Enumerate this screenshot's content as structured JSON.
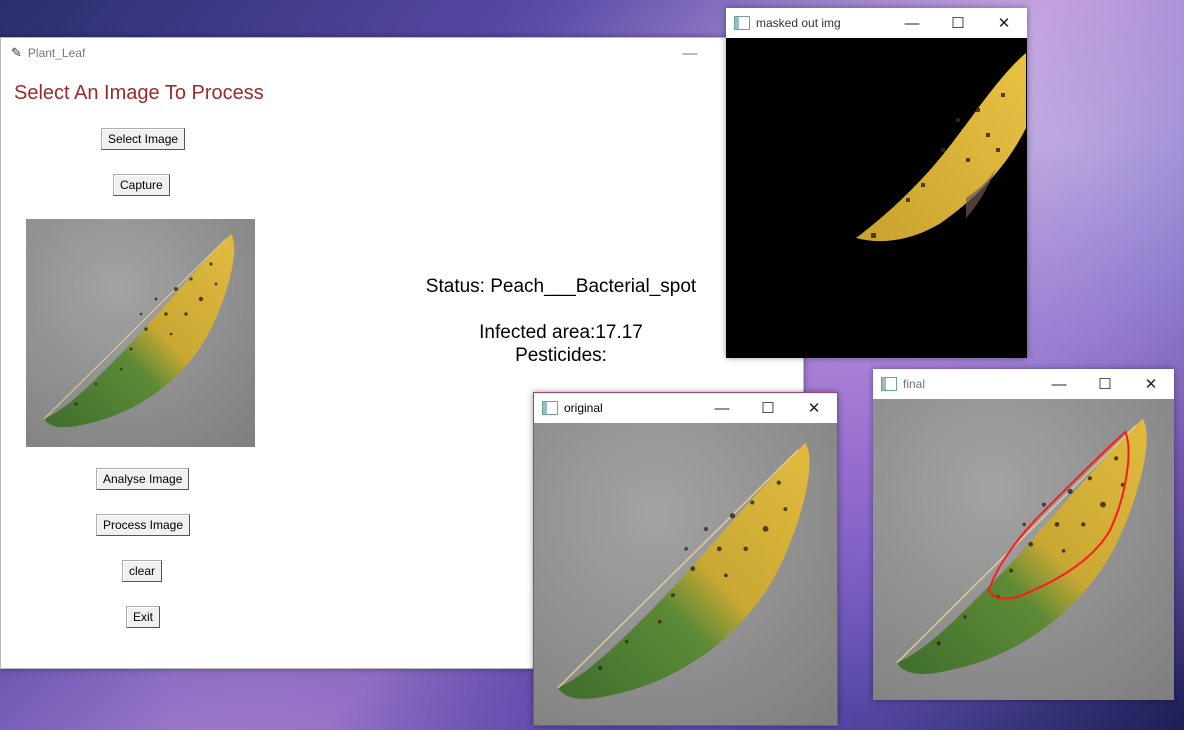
{
  "main_window": {
    "title": "Plant_Leaf",
    "minimize": "—",
    "heading": "Select An Image To Process",
    "buttons": {
      "select_image": "Select Image",
      "capture": "Capture",
      "analyse_image": "Analyse Image",
      "process_image": "Process Image",
      "clear": "clear",
      "exit": "Exit"
    },
    "status_text": "Status: Peach___Bacterial_spot",
    "infected_area_text": "Infected area:17.17",
    "pesticides_text": "Pesticides:"
  },
  "masked_window": {
    "title": "masked out img",
    "minimize": "—",
    "maximize": "☐",
    "close": "✕"
  },
  "original_window": {
    "title": "original",
    "minimize": "—",
    "maximize": "☐",
    "close": "✕"
  },
  "final_window": {
    "title": "final",
    "minimize": "—",
    "maximize": "☐",
    "close": "✕"
  },
  "colors": {
    "heading": "#9b2a2a",
    "leaf_yellow": "#d9b33a",
    "leaf_green": "#4f7a33",
    "contour": "#ff1a1a"
  }
}
